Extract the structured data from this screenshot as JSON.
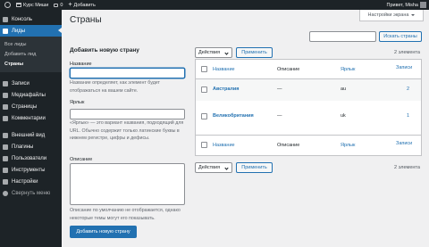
{
  "admin_bar": {
    "site_name": "Курс Миши",
    "comments_count": "0",
    "add_new": "Добавить",
    "greeting": "Привет, Misha"
  },
  "sidebar": {
    "items": [
      {
        "label": "Консоль",
        "icon": "dashboard-icon"
      },
      {
        "label": "Лиды",
        "icon": "pin-icon",
        "current": true
      },
      {
        "label": "Записи",
        "icon": "thumbtack-icon"
      },
      {
        "label": "Медиафайлы",
        "icon": "media-icon"
      },
      {
        "label": "Страницы",
        "icon": "pages-icon"
      },
      {
        "label": "Комментарии",
        "icon": "comments-icon"
      },
      {
        "label": "Внешний вид",
        "icon": "appearance-icon"
      },
      {
        "label": "Плагины",
        "icon": "plugins-icon"
      },
      {
        "label": "Пользователи",
        "icon": "users-icon"
      },
      {
        "label": "Инструменты",
        "icon": "tools-icon"
      },
      {
        "label": "Настройки",
        "icon": "settings-icon"
      },
      {
        "label": "Свернуть меню",
        "icon": "collapse-icon"
      }
    ],
    "submenu": [
      "Все лиды",
      "Добавить лид",
      "Страны"
    ]
  },
  "screen_options": "Настройки экрана",
  "page_title": "Страны",
  "search": {
    "button": "Искать страны",
    "value": ""
  },
  "form": {
    "heading": "Добавить новую страну",
    "name_label": "Название",
    "name_desc": "Название определяет, как элемент будет отображаться на вашем сайте.",
    "slug_label": "Ярлык",
    "slug_desc": "«Ярлык» — это вариант названия, подходящий для URL. Обычно содержит только латинские буквы в нижнем регистре, цифры и дефисы.",
    "description_label": "Описание",
    "description_desc": "Описание по умолчанию не отображается, однако некоторые темы могут его показывать.",
    "submit": "Добавить новую страну"
  },
  "table": {
    "bulk_action": "Действия",
    "apply": "Применить",
    "count": "2 элемента",
    "columns": {
      "name": "Название",
      "description": "Описание",
      "slug": "Ярлык",
      "posts": "Записи"
    },
    "rows": [
      {
        "name": "Австралия",
        "description": "—",
        "slug": "au",
        "posts": "2"
      },
      {
        "name": "Великобритания",
        "description": "—",
        "slug": "uk",
        "posts": "1"
      }
    ]
  },
  "colors": {
    "accent": "#2271b1",
    "sidebar": "#1d2327",
    "background": "#f0f0f1"
  }
}
